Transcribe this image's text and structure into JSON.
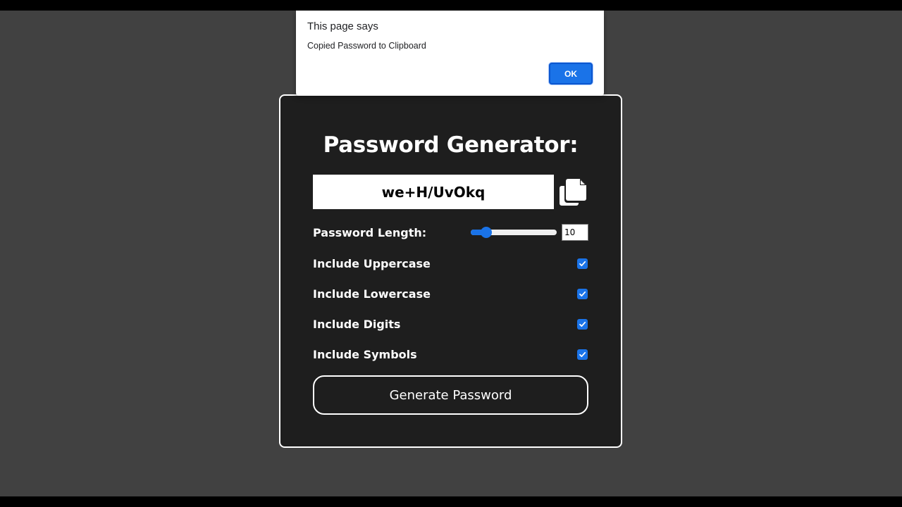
{
  "app": {
    "title": "Password Generator:"
  },
  "password": {
    "value": "we+H/UvOkq"
  },
  "length": {
    "label": "Password Length:",
    "value": "10",
    "min": 4,
    "max": 50
  },
  "options": [
    {
      "label": "Include Uppercase",
      "checked": true
    },
    {
      "label": "Include Lowercase",
      "checked": true
    },
    {
      "label": "Include Digits",
      "checked": true
    },
    {
      "label": "Include Symbols",
      "checked": true
    }
  ],
  "generate_button": {
    "label": "Generate Password"
  },
  "alert": {
    "title": "This page says",
    "message": "Copied Password to Clipboard",
    "ok_label": "OK"
  },
  "icons": {
    "copy": "copy-icon",
    "check": "check-icon"
  },
  "colors": {
    "page_bg": "#414141",
    "card_bg": "#1e1e1e",
    "accent": "#1a73e8",
    "text": "#ffffff"
  }
}
